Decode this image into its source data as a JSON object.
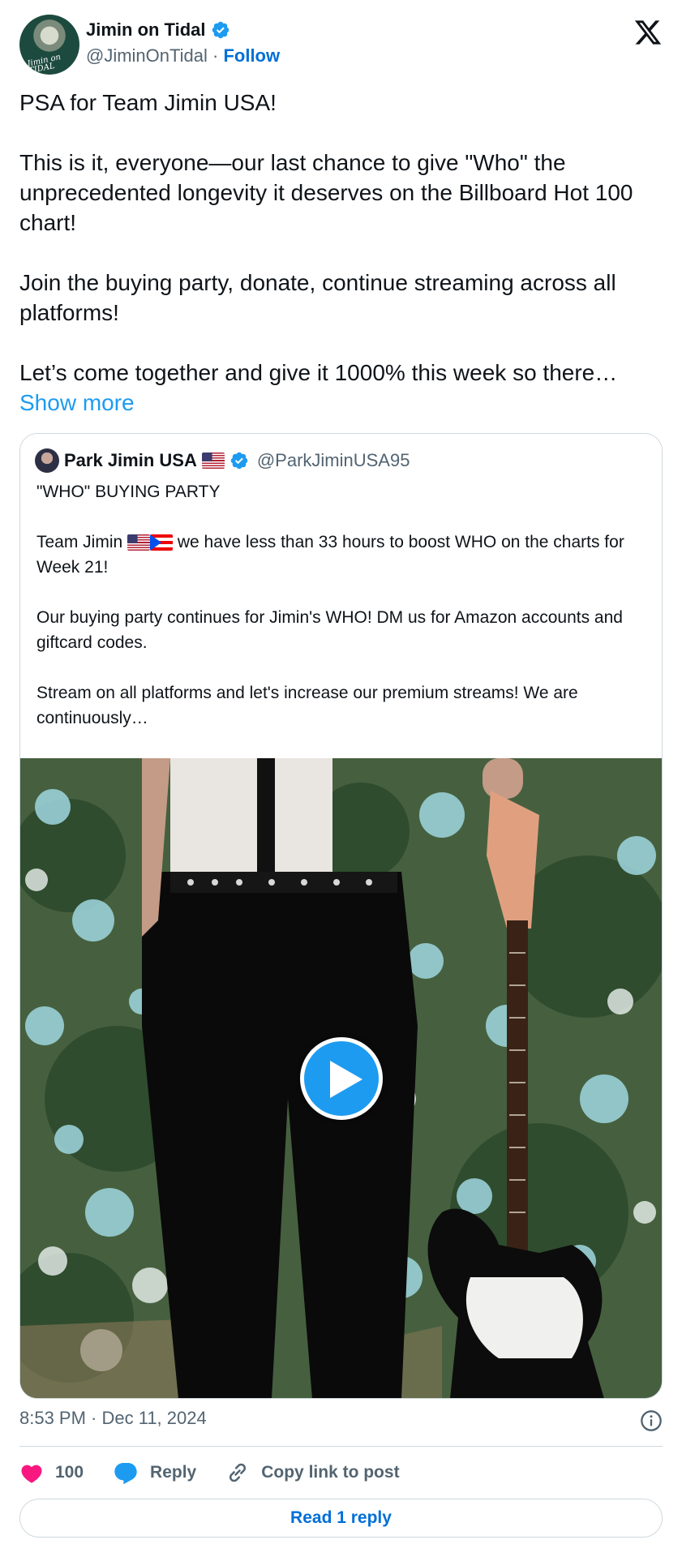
{
  "author": {
    "display_name": "Jimin on Tidal",
    "handle": "@JiminOnTidal",
    "separator": " · ",
    "follow_label": "Follow",
    "avatar_text": "Jimin on TIDAL",
    "verified_icon": "verified-badge-icon"
  },
  "tweet": {
    "text": "PSA for Team Jimin USA!\n\nThis is it, everyone—our last chance to give \"Who\" the unprecedented longevity it deserves on the Billboard Hot 100 chart!\n\nJoin the buying party, donate, continue streaming across all platforms!\n\nLet’s come together and give it 1000% this week so there… ",
    "show_more_label": "Show more"
  },
  "quote": {
    "display_name": "Park Jimin USA",
    "handle": "@ParkJiminUSA95",
    "text_title": "\"WHO\" BUYING PARTY",
    "text_team_prefix": "Team Jimin ",
    "text_team_suffix": " we have less than 33 hours to boost WHO on the charts for Week 21!",
    "text_rest": "Our buying party continues for Jimin's WHO! DM us for Amazon accounts and giftcard codes.\n\nStream on all platforms and let's increase our premium streams! We are continuously…",
    "media_play_icon": "play-icon"
  },
  "meta": {
    "timestamp": "8:53 PM · Dec 11, 2024"
  },
  "actions": {
    "like_count": "100",
    "reply_label": "Reply",
    "copy_label": "Copy link to post"
  },
  "footer": {
    "read_reply_label": "Read 1 reply"
  },
  "colors": {
    "link": "#006fd6",
    "accent": "#1d9bf0",
    "like": "#f91880",
    "muted": "#536471"
  }
}
